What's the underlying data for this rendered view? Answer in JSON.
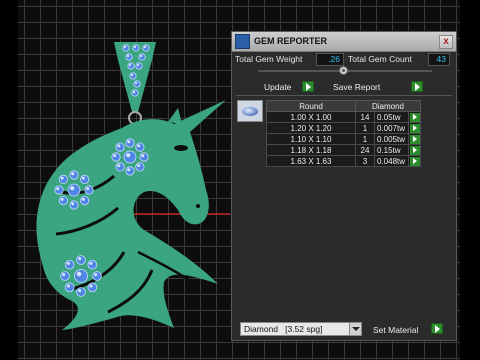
{
  "panel": {
    "title": "GEM REPORTER",
    "close_glyph": "x",
    "total_weight_label": "Total Gem Weight",
    "total_weight_value": ".26",
    "total_count_label": "Total Gem Count",
    "total_count_value": "43",
    "update_label": "Update",
    "save_report_label": "Save Report"
  },
  "table": {
    "headers": [
      "Round",
      "Diamond"
    ],
    "rows": [
      {
        "size": "1.00 X 1.00",
        "count": "14",
        "weight": "0.05tw"
      },
      {
        "size": "1.20 X 1.20",
        "count": "1",
        "weight": "0.007tw"
      },
      {
        "size": "1.10 X 1.10",
        "count": "1",
        "weight": "0.005tw"
      },
      {
        "size": "1.18 X 1.18",
        "count": "24",
        "weight": "0.15tw"
      },
      {
        "size": "1.63 X 1.63",
        "count": "3",
        "weight": "0.048tw"
      }
    ]
  },
  "material": {
    "selected": "Diamond   [3.52 spg]",
    "set_material_label": "Set Material"
  },
  "icons": {
    "app": "gem-reporter-app-icon",
    "gem": "round-gem-icon",
    "go": "green-arrow-icon"
  },
  "colors": {
    "model": "#3aa580",
    "gem": "#4f86e6",
    "value_text": "#31c0f0",
    "go_button": "#2d8c2d"
  }
}
